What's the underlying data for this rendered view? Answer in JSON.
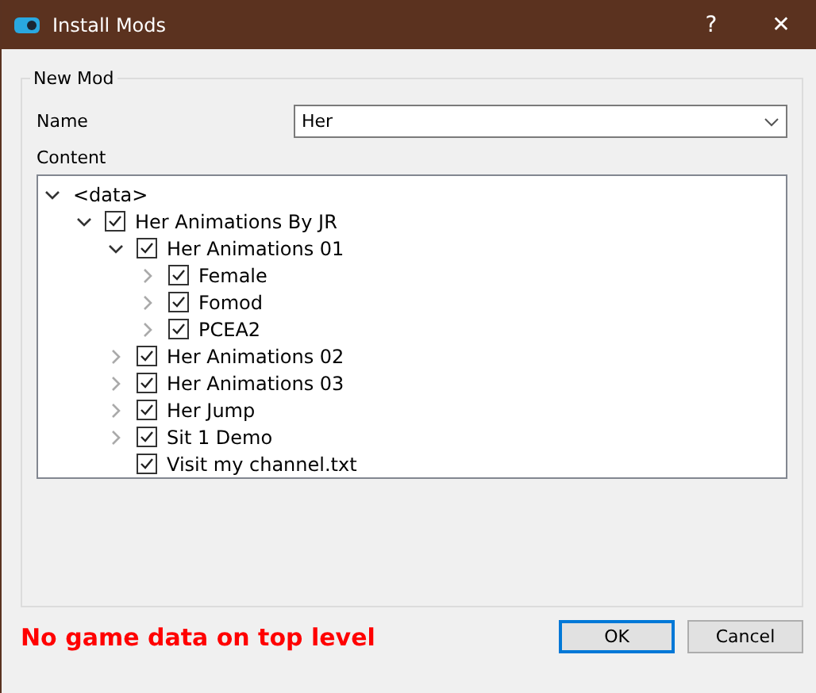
{
  "window": {
    "title": "Install Mods",
    "buttons": [
      "?",
      "✕"
    ]
  },
  "group": {
    "title": "New Mod",
    "name_label": "Name",
    "name_value": "Her",
    "content_label": "Content"
  },
  "tree": [
    {
      "label": "<data>",
      "kind": "root",
      "expanded": true,
      "children": [
        {
          "label": "Her Animations By JR",
          "kind": "folder",
          "expanded": true,
          "checked": true,
          "children": [
            {
              "label": "Her Animations 01",
              "kind": "folder",
              "expanded": true,
              "checked": true,
              "children": [
                {
                  "label": "Female",
                  "kind": "folder",
                  "expanded": false,
                  "checked": true
                },
                {
                  "label": "Fomod",
                  "kind": "folder",
                  "expanded": false,
                  "checked": true
                },
                {
                  "label": "PCEA2",
                  "kind": "folder",
                  "expanded": false,
                  "checked": true
                }
              ]
            },
            {
              "label": "Her Animations 02",
              "kind": "folder",
              "expanded": false,
              "checked": true
            },
            {
              "label": "Her Animations 03",
              "kind": "folder",
              "expanded": false,
              "checked": true
            },
            {
              "label": "Her Jump",
              "kind": "folder",
              "expanded": false,
              "checked": true
            },
            {
              "label": "Sit 1 Demo",
              "kind": "folder",
              "expanded": false,
              "checked": true
            },
            {
              "label": "Visit my channel.txt",
              "kind": "file",
              "checked": true
            }
          ]
        }
      ]
    }
  ],
  "message": "No game data on top level",
  "buttons": [
    {
      "label": "OK",
      "selected": true
    },
    {
      "label": "Cancel",
      "selected": false
    }
  ]
}
